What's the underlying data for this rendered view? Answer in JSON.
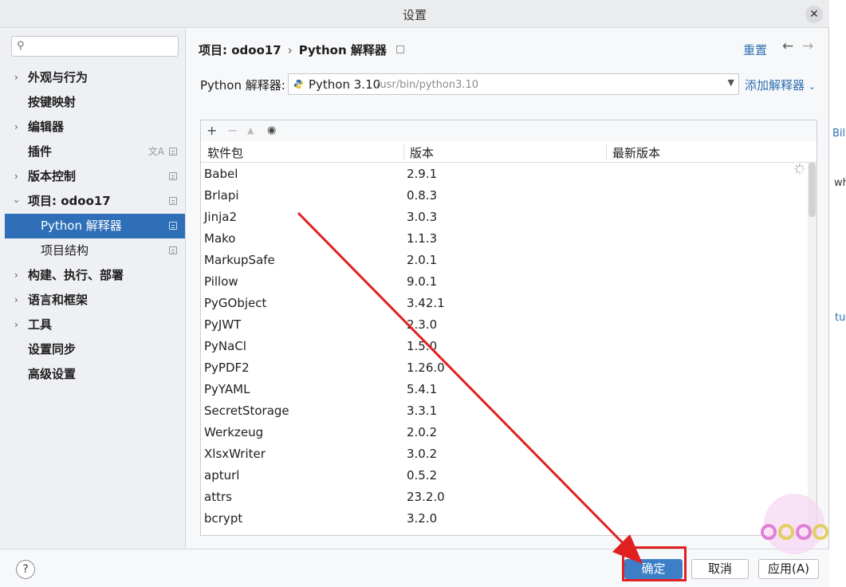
{
  "window": {
    "title": "设置",
    "close_icon": "✕"
  },
  "sidebar": {
    "search_placeholder": "",
    "items": [
      {
        "label": "外观与行为",
        "expandable": true
      },
      {
        "label": "按键映射",
        "expandable": false
      },
      {
        "label": "编辑器",
        "expandable": true
      },
      {
        "label": "插件",
        "expandable": false
      },
      {
        "label": "版本控制",
        "expandable": true
      },
      {
        "label": "项目: odoo17",
        "expandable": true,
        "expanded": true
      },
      {
        "label": "Python 解释器",
        "selected": true
      },
      {
        "label": "项目结构"
      },
      {
        "label": "构建、执行、部署",
        "expandable": true
      },
      {
        "label": "语言和框架",
        "expandable": true
      },
      {
        "label": "工具",
        "expandable": true
      },
      {
        "label": "设置同步",
        "expandable": false
      },
      {
        "label": "高级设置",
        "expandable": false
      }
    ]
  },
  "main": {
    "breadcrumb": {
      "project": "项目: odoo17",
      "separator": "›",
      "page": "Python 解释器"
    },
    "reset_label": "重置",
    "interpreter_label": "Python 解释器:",
    "interpreter_version": "Python 3.10",
    "interpreter_path": "/usr/bin/python3.10",
    "add_interpreter_label": "添加解释器",
    "toolbar": {
      "add": "+",
      "remove": "−",
      "up": "▲",
      "show": "◉"
    },
    "columns": [
      "软件包",
      "版本",
      "最新版本"
    ],
    "packages": [
      {
        "name": "Babel",
        "version": "2.9.1"
      },
      {
        "name": "Brlapi",
        "version": "0.8.3"
      },
      {
        "name": "Jinja2",
        "version": "3.0.3"
      },
      {
        "name": "Mako",
        "version": "1.1.3"
      },
      {
        "name": "MarkupSafe",
        "version": "2.0.1"
      },
      {
        "name": "Pillow",
        "version": "9.0.1"
      },
      {
        "name": "PyGObject",
        "version": "3.42.1"
      },
      {
        "name": "PyJWT",
        "version": "2.3.0"
      },
      {
        "name": "PyNaCl",
        "version": "1.5.0"
      },
      {
        "name": "PyPDF2",
        "version": "1.26.0"
      },
      {
        "name": "PyYAML",
        "version": "5.4.1"
      },
      {
        "name": "SecretStorage",
        "version": "3.3.1"
      },
      {
        "name": "Werkzeug",
        "version": "2.0.2"
      },
      {
        "name": "XlsxWriter",
        "version": "3.0.2"
      },
      {
        "name": "apturl",
        "version": "0.5.2"
      },
      {
        "name": "attrs",
        "version": "23.2.0"
      },
      {
        "name": "bcrypt",
        "version": "3.2.0"
      }
    ]
  },
  "footer": {
    "help_label": "?",
    "ok_label": "确定",
    "cancel_label": "取消",
    "apply_label": "应用(A)"
  },
  "background": {
    "text1": "Bill",
    "text2": "wh",
    "text3": "tut"
  },
  "colors": {
    "accent": "#2e6fb8",
    "link": "#2f6fb0",
    "annotation": "#e02020"
  }
}
